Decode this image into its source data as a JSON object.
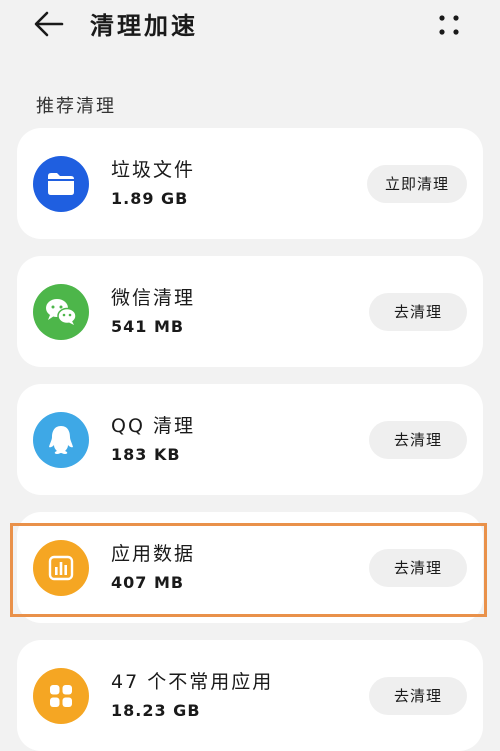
{
  "header": {
    "title": "清理加速",
    "back_icon": "arrow-left-icon",
    "more_icon": "more-dots-icon"
  },
  "section": {
    "title": "推荐清理"
  },
  "items": [
    {
      "name": "垃圾文件",
      "size": "1.89 GB",
      "action": "立即清理",
      "icon": "folder-icon",
      "icon_color": "#1f5fe0"
    },
    {
      "name": "微信清理",
      "size": "541 MB",
      "action": "去清理",
      "icon": "wechat-icon",
      "icon_color": "#4db64a"
    },
    {
      "name": "QQ 清理",
      "size": "183 KB",
      "action": "去清理",
      "icon": "qq-penguin-icon",
      "icon_color": "#3ea8e6"
    },
    {
      "name": "应用数据",
      "size": "407 MB",
      "action": "去清理",
      "icon": "app-data-chart-icon",
      "icon_color": "#f5a623"
    },
    {
      "name": "47 个不常用应用",
      "size": "18.23 GB",
      "action": "去清理",
      "icon": "grid-apps-icon",
      "icon_color": "#f5a623"
    }
  ],
  "highlight": {
    "color": "#e9914a",
    "target": "应用数据"
  }
}
